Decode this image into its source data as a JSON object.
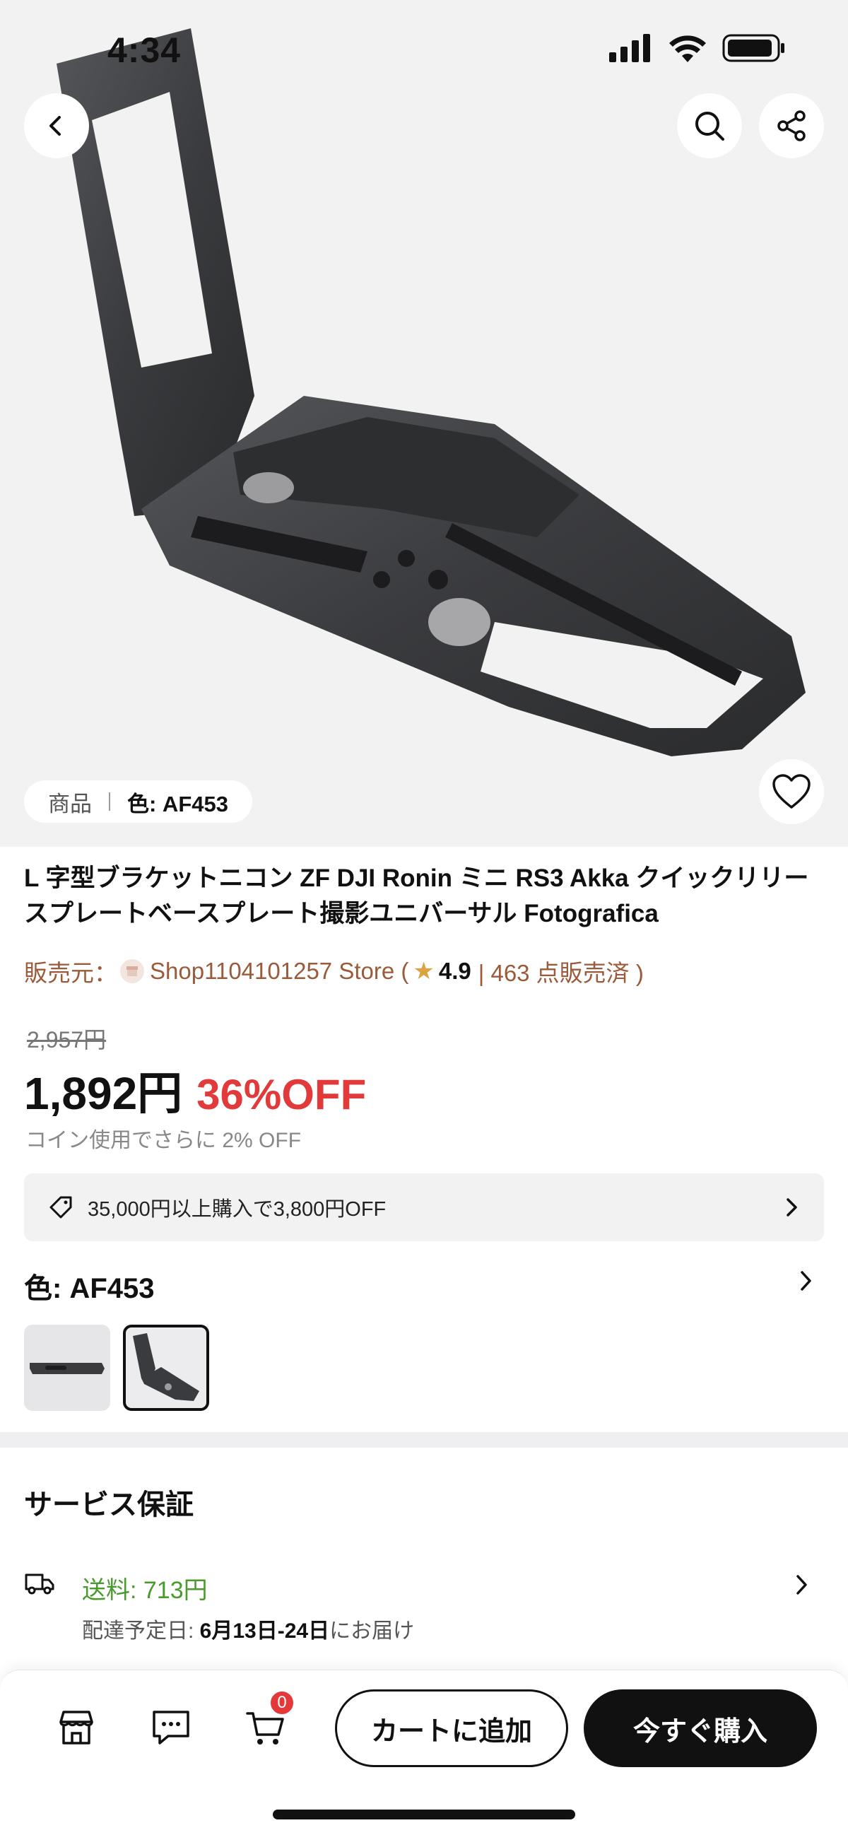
{
  "status_bar": {
    "time": "4:34"
  },
  "hero": {
    "variant_label": "商品",
    "variant_value": "色: AF453"
  },
  "product": {
    "title": "L 字型ブラケットニコン ZF DJI Ronin ミニ RS3 Akka クイックリリースプレートベースプレート撮影ユニバーサル Fotografica",
    "seller_prefix": "販売元：",
    "store_name": "Shop1104101257 Store (",
    "rating": "4.9",
    "sold": "| 463 点販売済 )",
    "original_price": "2,957円",
    "price": "1,892円",
    "discount": "36%OFF",
    "coin_note": "コイン使用でさらに 2% OFF",
    "coupon": "35,000円以上購入で3,800円OFF",
    "color_label": "色: AF453"
  },
  "service": {
    "title": "サービス保証",
    "shipping": "送料:  713円",
    "delivery_prefix": "配達予定日: ",
    "delivery_dates": "6月13日-24日",
    "delivery_suffix": "にお届け"
  },
  "bottom_bar": {
    "cart_count": "0",
    "add_to_cart": "カートに追加",
    "buy_now": "今すぐ購入"
  }
}
